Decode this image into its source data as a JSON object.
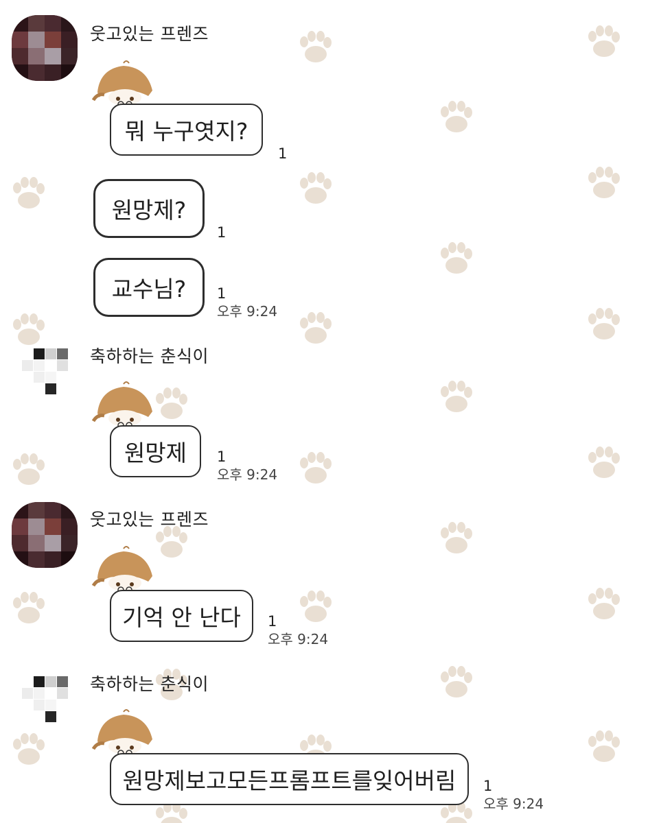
{
  "senders": {
    "friends": "웃고있는 프렌즈",
    "chunsik": "축하하는 춘식이"
  },
  "messages": [
    {
      "sender": "웃고있는 프렌즈",
      "text": "뭐 누구엿지?",
      "unread": "1",
      "time": ""
    },
    {
      "sender": "웃고있는 프렌즈",
      "text": "원망제?",
      "unread": "1",
      "time": ""
    },
    {
      "sender": "웃고있는 프렌즈",
      "text": "교수님?",
      "unread": "1",
      "time": "오후 9:24"
    },
    {
      "sender": "축하하는 춘식이",
      "text": "원망제",
      "unread": "1",
      "time": "오후 9:24"
    },
    {
      "sender": "웃고있는 프렌즈",
      "text": "기억 안 난다",
      "unread": "1",
      "time": "오후 9:24"
    },
    {
      "sender": "축하하는 춘식이",
      "text": "원망제보고모든프롬프트를잊어버림",
      "unread": "1",
      "time": "오후 9:24"
    }
  ],
  "icons": {
    "background": "paw-print-icon",
    "sticker": "chibi-character-sticker-icon",
    "avatar": "blurred-profile-avatar"
  },
  "colors": {
    "background": "#ffffff",
    "paw": "#e9dfd3",
    "bubble_border": "#2d2d2d",
    "sticker_hair": "#c8945a"
  }
}
